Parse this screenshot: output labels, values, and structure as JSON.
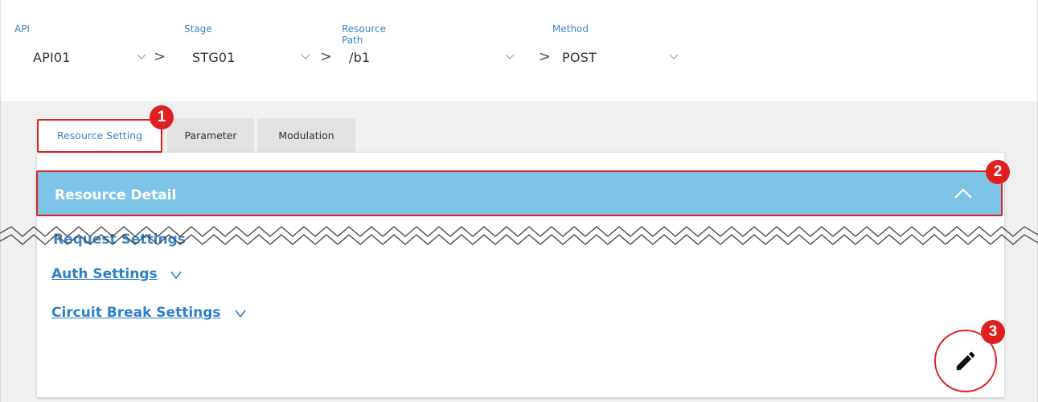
{
  "filters": [
    {
      "label": "API",
      "value": "API01"
    },
    {
      "label": "Stage",
      "value": "STG01"
    },
    {
      "label": "Resource Path",
      "value": "/b1"
    },
    {
      "label": "Method",
      "value": "POST"
    }
  ],
  "separator": ">",
  "tabs": [
    {
      "label": "Resource Setting",
      "active": true
    },
    {
      "label": "Parameter",
      "active": false
    },
    {
      "label": "Modulation",
      "active": false
    }
  ],
  "panel": {
    "title": "Resource Detail",
    "cut_peek_text": "Request Settings"
  },
  "settings": [
    {
      "label": "Auth Settings"
    },
    {
      "label": "Circuit Break Settings"
    }
  ],
  "badges": [
    "1",
    "2",
    "3"
  ],
  "icons": {
    "collapse": "chevron-up-icon",
    "edit": "pencil-icon",
    "expand": "chevron-down-icon"
  },
  "colors": {
    "accent": "#3a86c8",
    "header_bg": "#7ec3e8",
    "highlight": "#e02020",
    "content_bg": "#f0f0f0"
  }
}
